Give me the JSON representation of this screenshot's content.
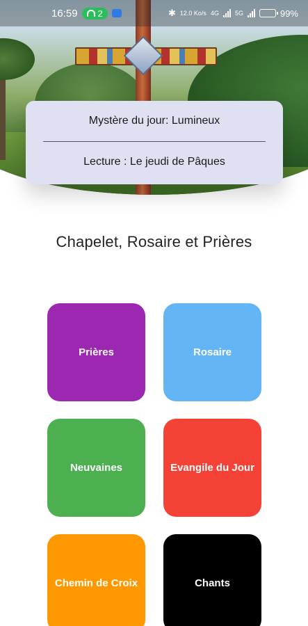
{
  "status_bar": {
    "time": "16:59",
    "wifi_badge": "2",
    "network_speed": "12.0 Ko/s",
    "network_types": [
      "4G",
      "5G"
    ],
    "battery_percent": 0.99,
    "battery_label": "99%"
  },
  "info_card": {
    "mystery_line": "Mystère du jour: Lumineux",
    "reading_line": "Lecture : Le jeudi de Pâques"
  },
  "app_title": "Chapelet, Rosaire et Prières",
  "tiles": [
    {
      "label": "Prières",
      "color": "#9c27b0"
    },
    {
      "label": "Rosaire",
      "color": "#64b5f6"
    },
    {
      "label": "Neuvaines",
      "color": "#4caf50"
    },
    {
      "label": "Evangile du Jour",
      "color": "#f44336"
    },
    {
      "label": "Chemin de Croix",
      "color": "#ff9800"
    },
    {
      "label": "Chants",
      "color": "#000000"
    }
  ]
}
